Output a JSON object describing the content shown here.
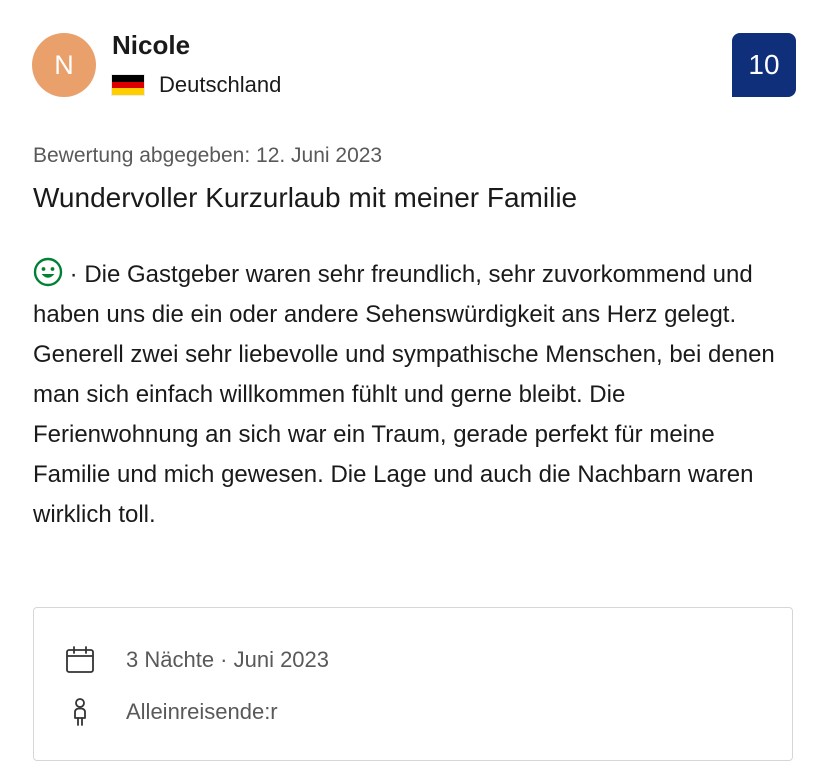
{
  "reviewer": {
    "initial": "N",
    "name": "Nicole",
    "country": "Deutschland",
    "avatar_color": "#e9a06b"
  },
  "score": {
    "value": "10",
    "color": "#0f2f7a"
  },
  "review": {
    "date_label": "Bewertung abgegeben: 12. Juni 2023",
    "title": "Wundervoller Kurzurlaub mit meiner Familie",
    "positive_prefix": " · ",
    "positive_text": "Die Gastgeber waren sehr freundlich, sehr zuvorkommend und haben uns die ein oder andere Sehenswürdigkeit ans Herz gelegt. Generell zwei sehr liebevolle und sympathische Menschen, bei denen man sich einfach willkommen fühlt und gerne bleibt. Die Ferienwohnung an sich war ein Traum, gerade perfekt für meine Familie und mich gewesen. Die Lage und auch die Nachbarn waren wirklich toll.",
    "positive_icon": "smile-icon",
    "positive_color": "#008234"
  },
  "stay": {
    "duration": "3 Nächte · Juni 2023",
    "traveler_type": "Alleinreisende:r",
    "duration_icon": "calendar-icon",
    "traveler_icon": "person-icon"
  },
  "flag_colors": [
    "#000000",
    "#dd0000",
    "#ffce00"
  ]
}
